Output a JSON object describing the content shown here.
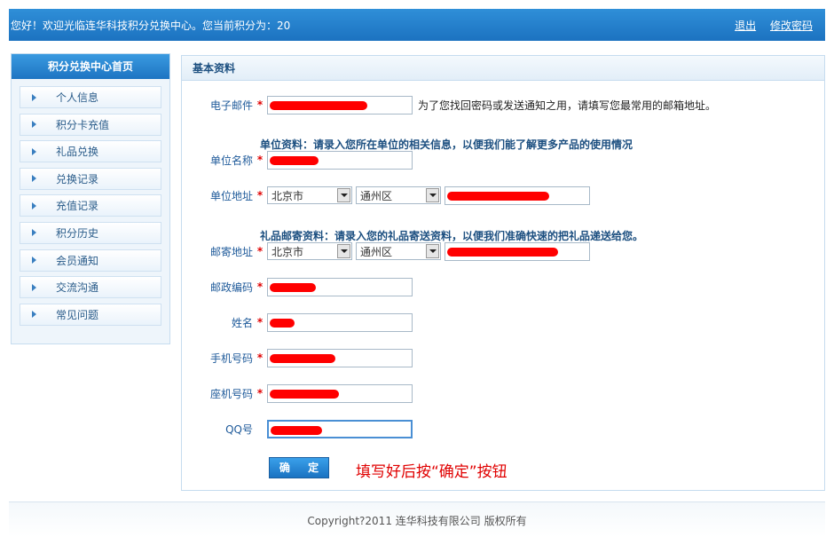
{
  "header": {
    "welcome": "您好！欢迎光临连华科技积分兑换中心。您当前积分为：20",
    "logout": "退出",
    "change_password": "修改密码"
  },
  "sidebar": {
    "home": "积分兑换中心首页",
    "items": [
      {
        "label": "个人信息"
      },
      {
        "label": "积分卡充值"
      },
      {
        "label": "礼品兑换"
      },
      {
        "label": "兑换记录"
      },
      {
        "label": "充值记录"
      },
      {
        "label": "积分历史"
      },
      {
        "label": "会员通知"
      },
      {
        "label": "交流沟通"
      },
      {
        "label": "常见问题"
      }
    ]
  },
  "panel": {
    "title": "基本资料",
    "required_mark": "*",
    "email": {
      "label": "电子邮件",
      "hint": "为了您找回密码或发送通知之用，请填写您最常用的邮箱地址。"
    },
    "section_unit": "单位资料：请录入您所在单位的相关信息，以便我们能了解更多产品的使用情况",
    "unit_name": {
      "label": "单位名称"
    },
    "unit_address": {
      "label": "单位地址",
      "province": "北京市",
      "district": "通州区"
    },
    "section_gift": "礼品邮寄资料：请录入您的礼品寄送资料，以便我们准确快速的把礼品递送给您。",
    "mail_address": {
      "label": "邮寄地址",
      "province": "北京市",
      "district": "通州区"
    },
    "postcode": {
      "label": "邮政编码"
    },
    "name": {
      "label": "姓名"
    },
    "mobile": {
      "label": "手机号码"
    },
    "phone": {
      "label": "座机号码"
    },
    "qq": {
      "label": "QQ号"
    },
    "submit": "确 定",
    "instruction": "填写好后按“确定”按钮"
  },
  "footer": {
    "copyright": "Copyright?2011 连华科技有限公司 版权所有"
  },
  "colors": {
    "accent": "#1c72c0",
    "required": "#e00000",
    "redaction": "#ff0000"
  }
}
